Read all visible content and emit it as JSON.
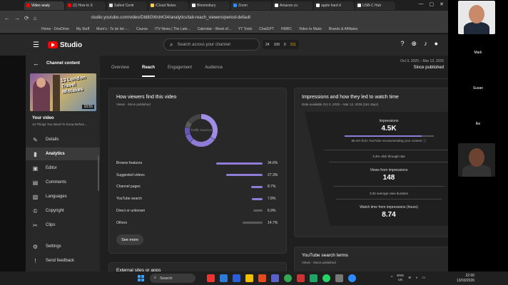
{
  "browser": {
    "tabs": [
      {
        "label": "Video analy",
        "color": "#ff0000",
        "active": true
      },
      {
        "label": "(2) How to S",
        "color": "#ff0000"
      },
      {
        "label": "Safest Centr",
        "color": "#e0e0e0"
      },
      {
        "label": "iCloud Notes",
        "color": "#f7d24a"
      },
      {
        "label": "Bloomsbury",
        "color": "#ffffff"
      },
      {
        "label": "Zoom",
        "color": "#2d8cff"
      },
      {
        "label": "Amazon.co.",
        "color": "#ffffff"
      },
      {
        "label": "apple hard d",
        "color": "#ffffff"
      },
      {
        "label": "USB-C Hub",
        "color": "#ffffff"
      }
    ],
    "url": "studio.youtube.com/video/Dbl8GWshK34/analytics/tab-reach_viewers/period-default",
    "bookmarks": [
      "Home - OneDrive",
      "My Stuff",
      "Mum's - To do list -...",
      "Course",
      "ITV News | The Late...",
      "Calendar - Week of...",
      "YT Tools",
      "ChatGPT",
      "HMRC",
      "Video to Make",
      "Brands & Affiliates"
    ]
  },
  "header": {
    "logo_text": "Studio",
    "search_placeholder": "Search across your channel",
    "ext_counts": [
      "24",
      "109",
      "0",
      "211"
    ]
  },
  "sidebar": {
    "title": "Channel content",
    "thumbnail_title": "13 London Travel Mistakes",
    "thumbnail_duration": "10:55",
    "your_video_label": "Your video",
    "video_title": "13 Things You Need To Know Before...",
    "items": [
      {
        "label": "Details",
        "icon": "✎",
        "active": false
      },
      {
        "label": "Analytics",
        "icon": "▮",
        "active": true
      },
      {
        "label": "Editor",
        "icon": "▣",
        "active": false
      },
      {
        "label": "Comments",
        "icon": "▤",
        "active": false
      },
      {
        "label": "Languages",
        "icon": "▧",
        "active": false
      },
      {
        "label": "Copyright",
        "icon": "©",
        "active": false
      },
      {
        "label": "Clips",
        "icon": "✂",
        "active": false
      }
    ],
    "bottom_items": [
      {
        "label": "Settings",
        "icon": "⚙"
      },
      {
        "label": "Send feedback",
        "icon": "!"
      }
    ]
  },
  "main": {
    "tabs": [
      {
        "label": "Overview",
        "active": false
      },
      {
        "label": "Reach",
        "active": true
      },
      {
        "label": "Engagement",
        "active": false
      },
      {
        "label": "Audience",
        "active": false
      }
    ],
    "date_range": "Oct 3, 2025 – Mar 13, 2026",
    "date_value": "Since published"
  },
  "traffic_card": {
    "title": "How viewers find this video",
    "subtitle": "Views · Since published",
    "donut_label": "Traffic Sources",
    "see_more": "See more",
    "sources": [
      {
        "label": "Browse features",
        "value": 34.6,
        "pct": "34.6%"
      },
      {
        "label": "Suggested videos",
        "value": 27.3,
        "pct": "27.3%"
      },
      {
        "label": "Channel pages",
        "value": 8.7,
        "pct": "8.7%"
      },
      {
        "label": "YouTube search",
        "value": 7.8,
        "pct": "7.8%"
      },
      {
        "label": "Direct or unknown",
        "value": 6.9,
        "pct": "6.9%"
      },
      {
        "label": "Others",
        "value": 14.7,
        "pct": "14.7%"
      }
    ]
  },
  "funnel_card": {
    "title": "Impressions and how they led to watch time",
    "subtitle": "Data available Oct 3, 2025 – Mar 12, 2026 (161 days)",
    "impressions_label": "Impressions",
    "impressions_value": "4.5K",
    "recommend_note": "86.4% from YouTube recommending your content",
    "recommend_fraction": 0.864,
    "ctr_note": "3.3% click through rate",
    "views_label": "Views from impressions",
    "views_value": "148",
    "avd_note": "3:32 average view duration",
    "watch_label": "Watch time from impressions (hours)",
    "watch_value": "8.74"
  },
  "lower": {
    "left_title": "External sites or apps",
    "right_title": "YouTube search terms",
    "right_sub": "Views · Since published"
  },
  "call": {
    "participants": [
      "Mark",
      "Susan",
      "Ike"
    ]
  },
  "taskbar": {
    "search_label": "Search",
    "lang": "ENG",
    "region": "UK",
    "time": "22:00",
    "date": "13/03/2026"
  }
}
